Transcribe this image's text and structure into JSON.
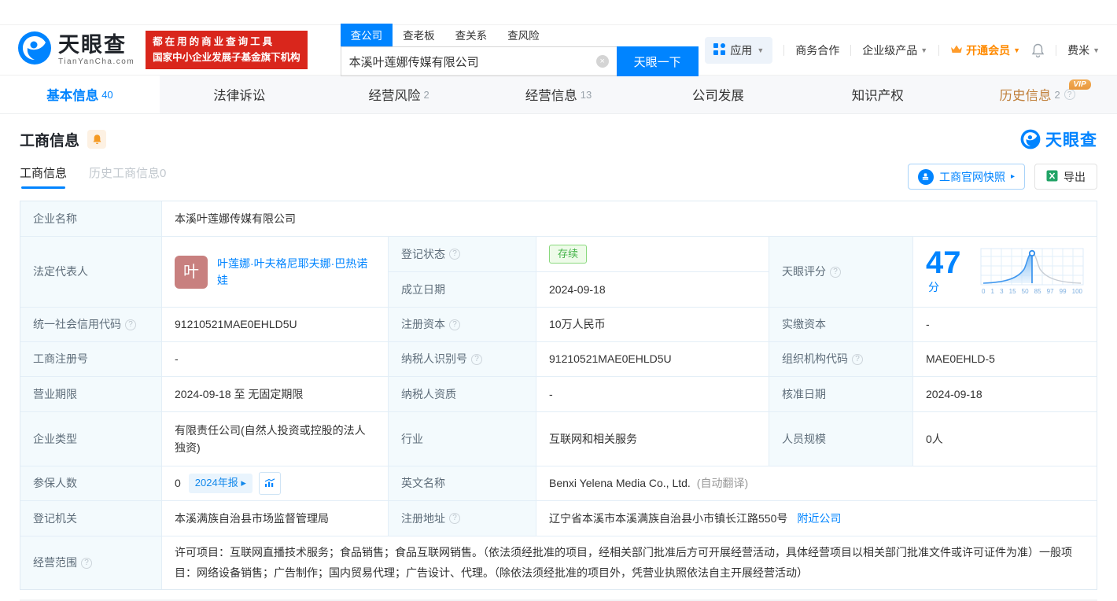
{
  "header": {
    "logo": {
      "title": "天眼查",
      "subtitle": "TianYanCha.com"
    },
    "promo": {
      "line1": "都在用的商业查询工具",
      "line2": "国家中小企业发展子基金旗下机构"
    },
    "search": {
      "tabs": [
        {
          "label": "查公司"
        },
        {
          "label": "查老板"
        },
        {
          "label": "查关系"
        },
        {
          "label": "查风险"
        }
      ],
      "value": "本溪叶莲娜传媒有限公司",
      "button": "天眼一下"
    },
    "menu": {
      "apps": "应用",
      "cooperation": "商务合作",
      "enterprise": "企业级产品",
      "vip": "开通会员",
      "user": "费米"
    }
  },
  "nav_tabs": [
    {
      "label": "基本信息",
      "count": "40"
    },
    {
      "label": "法律诉讼",
      "count": ""
    },
    {
      "label": "经营风险",
      "count": "2"
    },
    {
      "label": "经营信息",
      "count": "13"
    },
    {
      "label": "公司发展",
      "count": ""
    },
    {
      "label": "知识产权",
      "count": ""
    },
    {
      "label": "历史信息",
      "count": "2",
      "vip": "VIP"
    }
  ],
  "section": {
    "title": "工商信息",
    "brand": "天眼查",
    "subtabs": [
      {
        "label": "工商信息"
      },
      {
        "label": "历史工商信息0"
      }
    ],
    "snapshot_button": "工商官网快照",
    "export_button": "导出"
  },
  "table": {
    "company_name_label": "企业名称",
    "company_name": "本溪叶莲娜传媒有限公司",
    "legal_rep_label": "法定代表人",
    "legal_rep_avatar": "叶",
    "legal_rep_name": "叶莲娜·叶夫格尼耶夫娜·巴热诺娃",
    "reg_status_label": "登记状态",
    "reg_status": "存续",
    "establish_date_label": "成立日期",
    "establish_date": "2024-09-18",
    "score_label": "天眼评分",
    "score_value": "47",
    "score_unit": "分",
    "score_ticks": [
      "0",
      "1",
      "3",
      "15",
      "50",
      "85",
      "97",
      "99",
      "100"
    ],
    "credit_code_label": "统一社会信用代码",
    "credit_code": "91210521MAE0EHLD5U",
    "reg_capital_label": "注册资本",
    "reg_capital": "10万人民币",
    "paid_capital_label": "实缴资本",
    "paid_capital": "-",
    "reg_number_label": "工商注册号",
    "reg_number": "-",
    "taxpayer_id_label": "纳税人识别号",
    "taxpayer_id": "91210521MAE0EHLD5U",
    "org_code_label": "组织机构代码",
    "org_code": "MAE0EHLD-5",
    "business_term_label": "营业期限",
    "business_term": "2024-09-18 至 无固定期限",
    "taxpayer_qual_label": "纳税人资质",
    "taxpayer_qual": "-",
    "approval_date_label": "核准日期",
    "approval_date": "2024-09-18",
    "company_type_label": "企业类型",
    "company_type": "有限责任公司(自然人投资或控股的法人独资)",
    "industry_label": "行业",
    "industry": "互联网和相关服务",
    "staff_size_label": "人员规模",
    "staff_size": "0人",
    "insured_label": "参保人数",
    "insured": "0",
    "annual_report": "2024年报",
    "english_name_label": "英文名称",
    "english_name": "Benxi Yelena Media Co., Ltd.",
    "english_name_note": "(自动翻译)",
    "reg_authority_label": "登记机关",
    "reg_authority": "本溪满族自治县市场监督管理局",
    "address_label": "注册地址",
    "address": "辽宁省本溪市本溪满族自治县小市镇长江路550号",
    "nearby_link": "附近公司",
    "business_scope_label": "经营范围",
    "business_scope": "许可项目：互联网直播技术服务；食品销售；食品互联网销售。（依法须经批准的项目，经相关部门批准后方可开展经营活动，具体经营项目以相关部门批准文件或许可证件为准）一般项目：网络设备销售；广告制作；国内贸易代理；广告设计、代理。（除依法须经批准的项目外，凭营业执照依法自主开展经营活动）"
  }
}
